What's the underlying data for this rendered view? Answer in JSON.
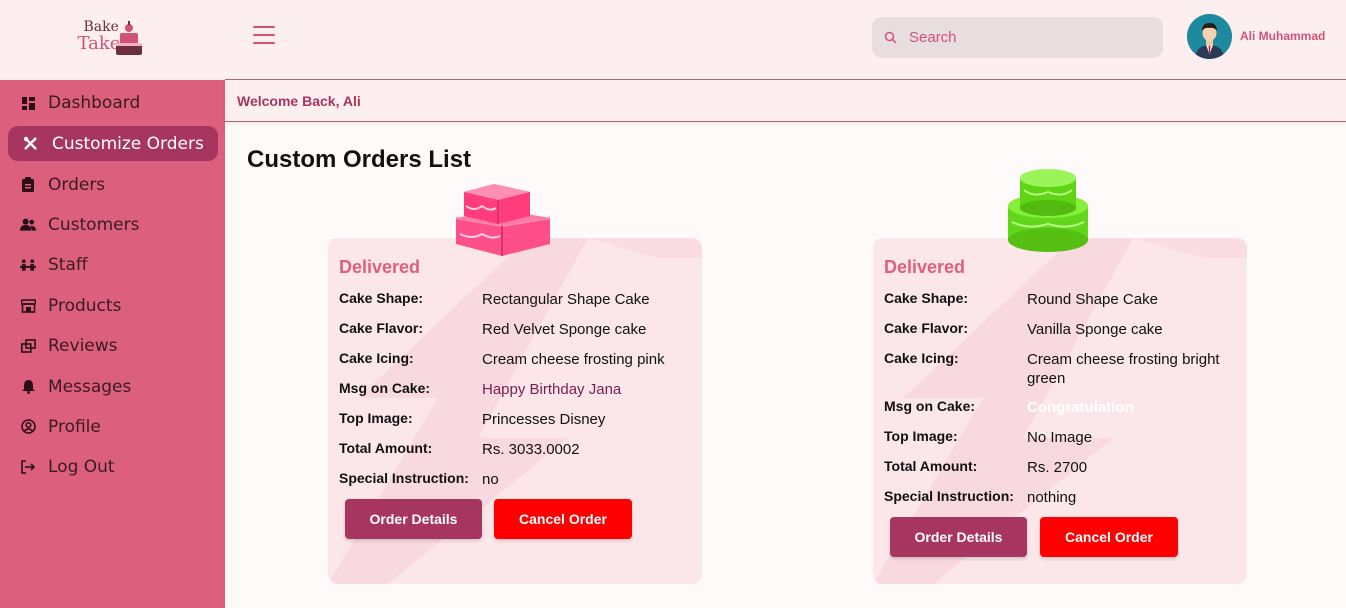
{
  "brand": {
    "logo_word1": "Bake",
    "logo_word2": "Take"
  },
  "sidebar": {
    "items": [
      {
        "label": "Dashboard",
        "icon": "dashboard-icon"
      },
      {
        "label": "Customize Orders",
        "icon": "tools-icon",
        "active": true
      },
      {
        "label": "Orders",
        "icon": "clipboard-icon"
      },
      {
        "label": "Customers",
        "icon": "users-icon"
      },
      {
        "label": "Staff",
        "icon": "staff-icon"
      },
      {
        "label": "Products",
        "icon": "store-icon"
      },
      {
        "label": "Reviews",
        "icon": "reviews-icon"
      },
      {
        "label": "Messages",
        "icon": "bell-icon"
      },
      {
        "label": "Profile",
        "icon": "user-circle-icon"
      },
      {
        "label": "Log Out",
        "icon": "logout-icon"
      }
    ]
  },
  "header": {
    "search_placeholder": "Search",
    "user_name": "Ali Muhammad",
    "welcome": "Welcome Back, Ali"
  },
  "page": {
    "title": "Custom Orders List"
  },
  "labels": {
    "shape": "Cake Shape:",
    "flavor": "Cake Flavor:",
    "icing": "Cake Icing:",
    "msg": "Msg on Cake:",
    "top_image": "Top Image:",
    "total": "Total Amount:",
    "special": "Special Instruction:",
    "details_button": "Order Details",
    "cancel_button": "Cancel Order"
  },
  "orders": [
    {
      "status": "Delivered",
      "cake_image": "pink-rectangular-cake",
      "shape": "Rectangular Shape Cake",
      "flavor": "Red Velvet Sponge cake",
      "icing": "Cream cheese frosting pink",
      "msg": "Happy Birthday Jana",
      "msg_color": "#7a1e4e",
      "top_image": "Princesses Disney",
      "total": "Rs. 3033.0002",
      "special": "no"
    },
    {
      "status": "Delivered",
      "cake_image": "green-round-cake",
      "shape": "Round Shape Cake",
      "flavor": "Vanilla Sponge cake",
      "icing": "Cream cheese frosting bright green",
      "msg": "Congratulation",
      "msg_color": "#ffffff",
      "top_image": "No Image",
      "total": "Rs. 2700",
      "special": "nothing"
    }
  ],
  "colors": {
    "sidebar": "#dc607e",
    "active": "#a63660",
    "accent": "#d2537a",
    "cancel": "#ff0000"
  }
}
